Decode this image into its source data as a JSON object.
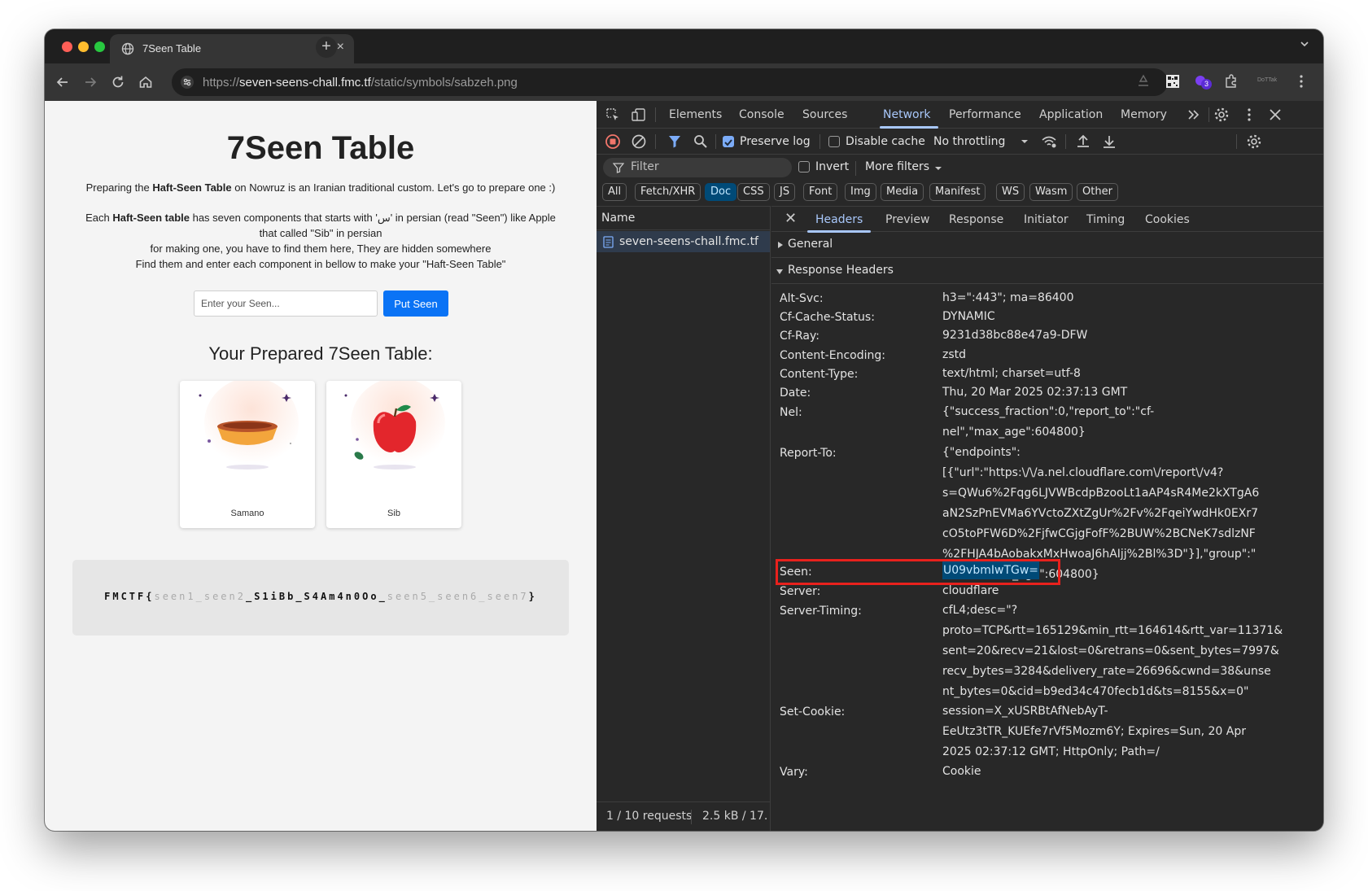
{
  "browser": {
    "tab_title": "7Seen Table",
    "url_scheme": "https://",
    "url_host": "seven-seens-chall.fmc.tf",
    "url_path": "/static/symbols/sabzeh.png",
    "extension_badge": "3",
    "profile_label": "DoTTak"
  },
  "page": {
    "title": "7Seen Table",
    "intro_pre": "Preparing the ",
    "intro_bold": "Haft-Seen Table",
    "intro_post": " on Nowruz is an Iranian traditional custom. Let's go to prepare one :)",
    "desc_pre": "Each ",
    "desc_bold": "Haft-Seen table",
    "desc_line1_post": " has seven components that starts with 'س' in persian (read \"Seen\") like Apple",
    "desc_line2": "that called \"Sib\" in persian",
    "desc_line3": "for making one, you have to find them here, They are hidden somewhere",
    "desc_line4": "Find them and enter each component in bellow to make your \"Haft-Seen Table\"",
    "input_placeholder": "Enter your Seen...",
    "button_label": "Put Seen",
    "subtitle": "Your Prepared 7Seen Table:",
    "cards": [
      {
        "label": "Samano"
      },
      {
        "label": "Sib"
      }
    ],
    "flag": {
      "prefix": "FMCTF{",
      "seen1": "seen1",
      "sep1": "_",
      "seen2": "seen2",
      "found": "_S1iBb_S4Am4n0Oo_",
      "seen5": "seen5",
      "sep2": "_",
      "seen6": "seen6",
      "sep3": "_",
      "seen7": "seen7",
      "suffix": "}"
    }
  },
  "devtools": {
    "tabs": [
      "Elements",
      "Console",
      "Sources",
      "Network",
      "Performance",
      "Application",
      "Memory"
    ],
    "active_tab": "Network",
    "preserve_log": "Preserve log",
    "disable_cache": "Disable cache",
    "throttling": "No throttling",
    "filter_placeholder": "Filter",
    "invert": "Invert",
    "more_filters": "More filters",
    "type_filters": [
      "All",
      "Fetch/XHR",
      "Doc",
      "CSS",
      "JS",
      "Font",
      "Img",
      "Media",
      "Manifest",
      "WS",
      "Wasm",
      "Other"
    ],
    "active_filter": "Doc",
    "list_header": "Name",
    "request_name": "seven-seens-chall.fmc.tf",
    "status_requests": "1 / 10 requests",
    "status_size": "2.5 kB / 17.",
    "detail_tabs": [
      "Headers",
      "Preview",
      "Response",
      "Initiator",
      "Timing",
      "Cookies"
    ],
    "active_detail_tab": "Headers",
    "section_general": "General",
    "section_response": "Response Headers",
    "headers": [
      {
        "name": "Alt-Svc:",
        "value": "h3=\":443\"; ma=86400"
      },
      {
        "name": "Cf-Cache-Status:",
        "value": "DYNAMIC"
      },
      {
        "name": "Cf-Ray:",
        "value": "9231d38bc88e47a9-DFW"
      },
      {
        "name": "Content-Encoding:",
        "value": "zstd"
      },
      {
        "name": "Content-Type:",
        "value": "text/html; charset=utf-8"
      },
      {
        "name": "Date:",
        "value": "Thu, 20 Mar 2025 02:37:13 GMT"
      },
      {
        "name": "Nel:",
        "value": "{\"success_fraction\":0,\"report_to\":\"cf-\nnel\",\"max_age\":604800}"
      },
      {
        "name": "Report-To:",
        "value": "{\"endpoints\":\n[{\"url\":\"https:\\/\\/a.nel.cloudflare.com\\/report\\/v4?\ns=QWu6%2Fqg6LJVWBcdpBzooLt1aAP4sR4Me2kXTgA6\naN2SzPnEVMa6YVctoZXtZgUr%2Fv%2FqeiYwdHk0EXr7\ncO5toPFW6D%2FjfwCGjgFofF%2BUW%2BCNeK7sdlzNF\n%2FHJA4bAobakxMxHwoaJ6hAIjj%2Bl%3D\"}],\"group\":\"\ncf-nel\",\"max_age\":604800}"
      },
      {
        "name": "Seen:",
        "value": "U09vbmIwTGw=",
        "highlight": true
      },
      {
        "name": "Server:",
        "value": "cloudflare"
      },
      {
        "name": "Server-Timing:",
        "value": "cfL4;desc=\"?\nproto=TCP&rtt=165129&min_rtt=164614&rtt_var=11371&\nsent=20&recv=21&lost=0&retrans=0&sent_bytes=7997&\nrecv_bytes=3284&delivery_rate=26696&cwnd=38&unse\nnt_bytes=0&cid=b9ed34c470fecb1d&ts=8155&x=0\""
      },
      {
        "name": "Set-Cookie:",
        "value": "session=X_xUSRBtAfNebAyT-\nEeUtz3tTR_KUEfe7rVf5Mozm6Y; Expires=Sun, 20 Apr\n2025 02:37:12 GMT; HttpOnly; Path=/"
      },
      {
        "name": "Vary:",
        "value": "Cookie"
      }
    ]
  },
  "colors": {
    "accent_blue": "#0a73f5",
    "devtools_accent": "#a8c7fa",
    "highlight_box": "#e8211d"
  }
}
